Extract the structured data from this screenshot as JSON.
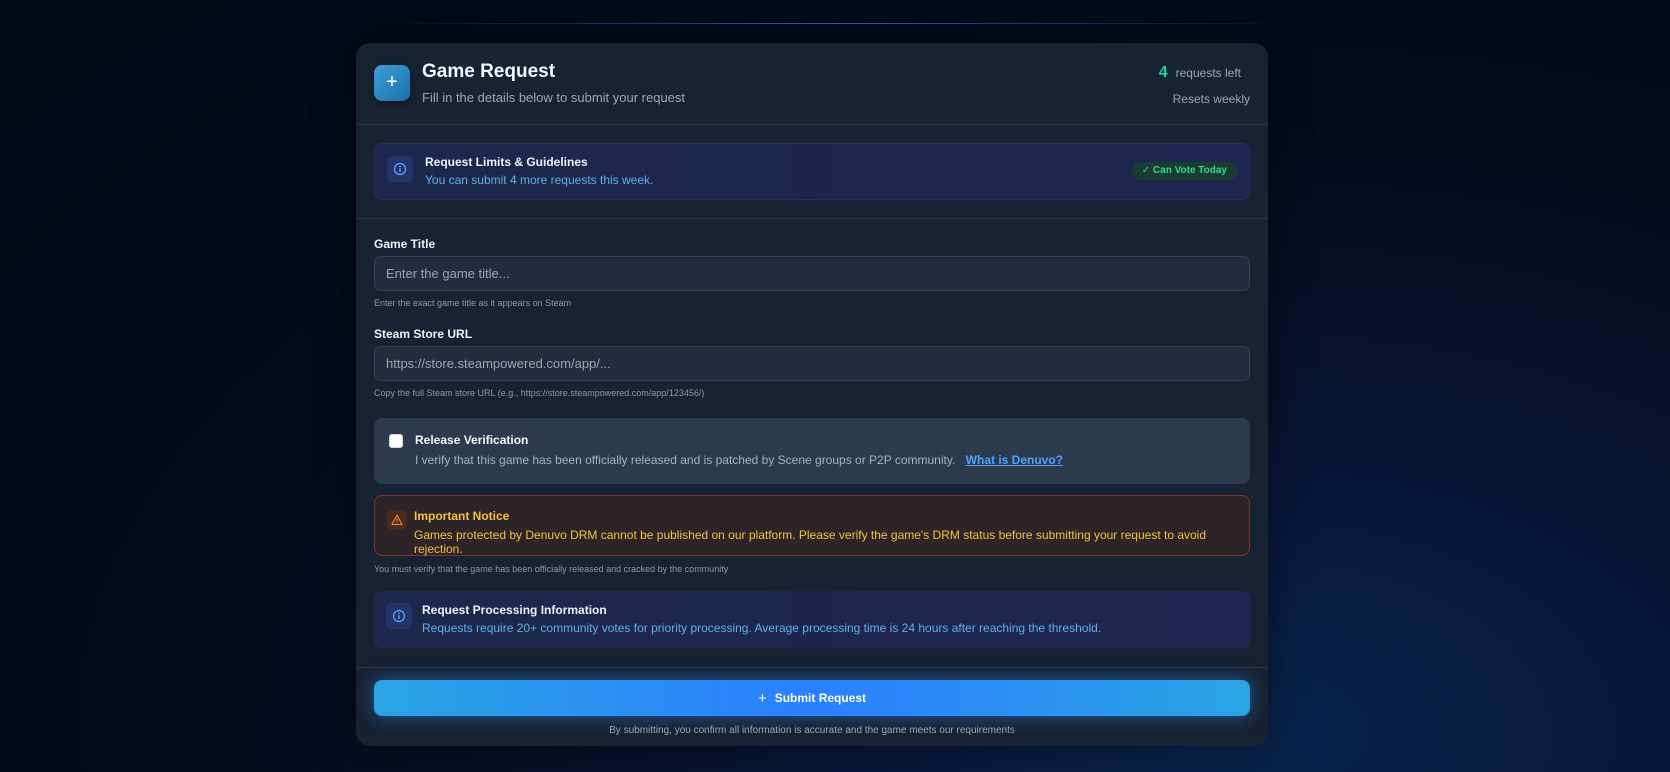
{
  "header": {
    "icon": "plus-icon",
    "title": "Game Request",
    "subtitle": "Fill in the details below to submit your request",
    "requests_left_count": "4",
    "requests_left_label": "requests left",
    "resets": "Resets weekly"
  },
  "guidelines": {
    "icon": "info-icon",
    "title": "Request Limits & Guidelines",
    "text": "You can submit 4 more requests this week.",
    "badge": "Can Vote Today"
  },
  "form": {
    "game_title_label": "Game Title",
    "game_title_placeholder": "Enter the game title...",
    "game_title_value": "",
    "game_title_hint": "Enter the exact game title as it appears on Steam",
    "steam_url_label": "Steam Store URL",
    "steam_url_placeholder": "https://store.steampowered.com/app/...",
    "steam_url_value": "",
    "steam_url_hint": "Copy the full Steam store URL (e.g., https://store.steampowered.com/app/123456/)"
  },
  "verification": {
    "checked": false,
    "title": "Release Verification",
    "text": "I verify that this game has been officially released and is patched by Scene groups or P2P community.",
    "link": "What is Denuvo?"
  },
  "notice": {
    "icon": "warning-icon",
    "title": "Important Notice",
    "text": "Games protected by Denuvo DRM cannot be published on our platform. Please verify the game's DRM status before submitting your request to avoid rejection.",
    "hint": "You must verify that the game has been officially released and cracked by the community"
  },
  "processing": {
    "icon": "info-icon",
    "title": "Request Processing Information",
    "text": "Requests require 20+ community votes for priority processing. Average processing time is 24 hours after reaching the threshold."
  },
  "footer": {
    "submit_label": "Submit Request",
    "disclaimer": "By submitting, you confirm all information is accurate and the game meets our requirements"
  },
  "colors": {
    "accent": "#2b7fff",
    "success": "#22d39a",
    "warning": "#f5c242",
    "info_text": "#5fb0f0"
  }
}
